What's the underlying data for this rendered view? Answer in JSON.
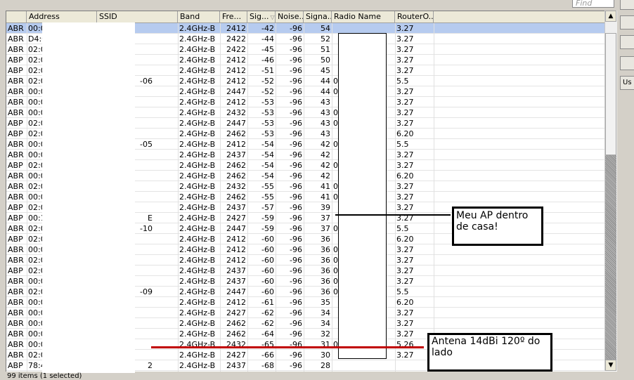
{
  "search": {
    "placeholder": "Find"
  },
  "columns": [
    "",
    "Address",
    "SSID",
    "Band",
    "Fre...",
    "Sig...",
    "Noise...",
    "Signa...",
    "Radio Name",
    "RouterO..."
  ],
  "sort_indicator": "▽",
  "scroll": {
    "up": "▲",
    "down": "▼",
    "position": 0.55
  },
  "rows": [
    [
      "ABR",
      "00:0",
      "",
      "2.4GHz-B",
      "2412",
      "-42",
      "-96",
      "54",
      "",
      "3.27"
    ],
    [
      "ABR",
      "D4:0",
      "",
      "2.4GHz-B",
      "2422",
      "-44",
      "-96",
      "52",
      "",
      "3.27"
    ],
    [
      "ABR",
      "02:0",
      "",
      "2.4GHz-B",
      "2422",
      "-45",
      "-96",
      "51",
      "",
      "3.27"
    ],
    [
      "ABP",
      "02:0",
      "",
      "2.4GHz-B",
      "2412",
      "-46",
      "-96",
      "50",
      "",
      "3.27"
    ],
    [
      "ABP",
      "02:0",
      "",
      "2.4GHz-B",
      "2412",
      "-51",
      "-96",
      "45",
      "",
      "3.27"
    ],
    [
      "ABR",
      "02:0",
      "-06",
      "2.4GHz-B",
      "2412",
      "-52",
      "-96",
      "44",
      "0",
      "5.5"
    ],
    [
      "ABR",
      "00:0",
      "",
      "2.4GHz-B",
      "2447",
      "-52",
      "-96",
      "44",
      "0",
      "3.27"
    ],
    [
      "ABR",
      "00:0",
      "",
      "2.4GHz-B",
      "2412",
      "-53",
      "-96",
      "43",
      "",
      "3.27"
    ],
    [
      "ABR",
      "00:0",
      "",
      "2.4GHz-B",
      "2432",
      "-53",
      "-96",
      "43",
      "0",
      "3.27"
    ],
    [
      "ABP",
      "02:0",
      "",
      "2.4GHz-B",
      "2447",
      "-53",
      "-96",
      "43",
      "0",
      "3.27"
    ],
    [
      "ABP",
      "02:0",
      "",
      "2.4GHz-B",
      "2462",
      "-53",
      "-96",
      "43",
      "",
      "6.20"
    ],
    [
      "ABR",
      "00:0",
      "-05",
      "2.4GHz-B",
      "2412",
      "-54",
      "-96",
      "42",
      "0",
      "5.5"
    ],
    [
      "ABR",
      "00:0",
      "",
      "2.4GHz-B",
      "2437",
      "-54",
      "-96",
      "42",
      "",
      "3.27"
    ],
    [
      "ABP",
      "02:0",
      "",
      "2.4GHz-B",
      "2462",
      "-54",
      "-96",
      "42",
      "0",
      "3.27"
    ],
    [
      "ABR",
      "00:0",
      "",
      "2.4GHz-B",
      "2462",
      "-54",
      "-96",
      "42",
      "",
      "6.20"
    ],
    [
      "ABR",
      "02:0",
      "",
      "2.4GHz-B",
      "2432",
      "-55",
      "-96",
      "41",
      "0",
      "3.27"
    ],
    [
      "ABR",
      "00:0",
      "",
      "2.4GHz-B",
      "2462",
      "-55",
      "-96",
      "41",
      "0",
      "3.27"
    ],
    [
      "ABP",
      "02:0",
      "",
      "2.4GHz-B",
      "2437",
      "-57",
      "-96",
      "39",
      "",
      "3.27"
    ],
    [
      "ABP",
      "00:1",
      "E",
      "2.4GHz-B",
      "2427",
      "-59",
      "-96",
      "37",
      "",
      "3.27"
    ],
    [
      "ABR",
      "02:0",
      "-10",
      "2.4GHz-B",
      "2447",
      "-59",
      "-96",
      "37",
      "0",
      "5.5"
    ],
    [
      "ABP",
      "02:0",
      "",
      "2.4GHz-B",
      "2412",
      "-60",
      "-96",
      "36",
      "",
      "6.20"
    ],
    [
      "ABR",
      "00:0",
      "",
      "2.4GHz-B",
      "2412",
      "-60",
      "-96",
      "36",
      "0",
      "3.27"
    ],
    [
      "ABR",
      "02:0",
      "",
      "2.4GHz-B",
      "2412",
      "-60",
      "-96",
      "36",
      "0",
      "3.27"
    ],
    [
      "ABP",
      "02:0",
      "",
      "2.4GHz-B",
      "2437",
      "-60",
      "-96",
      "36",
      "0",
      "3.27"
    ],
    [
      "ABR",
      "00:0",
      "",
      "2.4GHz-B",
      "2437",
      "-60",
      "-96",
      "36",
      "0",
      "3.27"
    ],
    [
      "ABR",
      "02:0",
      "-09",
      "2.4GHz-B",
      "2447",
      "-60",
      "-96",
      "36",
      "0",
      "5.5"
    ],
    [
      "ABR",
      "00:0",
      "",
      "2.4GHz-B",
      "2412",
      "-61",
      "-96",
      "35",
      "",
      "6.20"
    ],
    [
      "ABR",
      "00:0",
      "",
      "2.4GHz-B",
      "2427",
      "-62",
      "-96",
      "34",
      "",
      "3.27"
    ],
    [
      "ABR",
      "00:0",
      "",
      "2.4GHz-B",
      "2462",
      "-62",
      "-96",
      "34",
      "",
      "3.27"
    ],
    [
      "ABR",
      "00:0",
      "",
      "2.4GHz-B",
      "2462",
      "-64",
      "-96",
      "32",
      "",
      "3.27"
    ],
    [
      "ABR",
      "00:0",
      "",
      "2.4GHz-B",
      "2432",
      "-65",
      "-96",
      "31",
      "0",
      "5.26"
    ],
    [
      "ABR",
      "02:0",
      "",
      "2.4GHz-B",
      "2427",
      "-66",
      "-96",
      "30",
      "",
      "3.27"
    ],
    [
      "ABP",
      "78:4",
      "2",
      "2.4GHz-B",
      "2437",
      "-68",
      "-96",
      "28",
      "",
      ""
    ]
  ],
  "selected_row": 0,
  "status": "99 items (1 selected)",
  "side_buttons": [
    "",
    "",
    "",
    "",
    "Us"
  ],
  "annotations": {
    "ap": "Meu AP dentro de casa!",
    "antenna": "Antena 14dBi 120º do lado"
  },
  "colors": {
    "annotation_red": "#c00000",
    "selection": "#b6cbef"
  }
}
